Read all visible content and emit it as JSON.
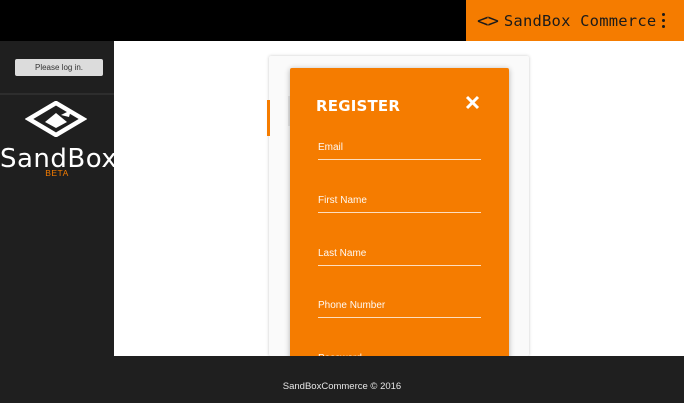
{
  "header": {
    "brand_glyph": "<>",
    "brand_name": "SandBox Commerce",
    "menu_icon": "more-vert-icon",
    "brand_color": "#f57c00",
    "bar_color": "#000000"
  },
  "sidebar": {
    "login_label": "Please log in.",
    "logo_icon": "sandbox-logo-icon",
    "logo_word": "SandBox",
    "logo_tag": "BETA"
  },
  "register": {
    "title": "REGISTER",
    "close_icon": "close-icon",
    "fields": {
      "email": {
        "placeholder": "Email",
        "value": ""
      },
      "first_name": {
        "placeholder": "First Name",
        "value": ""
      },
      "last_name": {
        "placeholder": "Last Name",
        "value": ""
      },
      "phone": {
        "placeholder": "Phone Number",
        "value": ""
      },
      "password": {
        "placeholder": "Password",
        "value": ""
      }
    },
    "accent": "#f57c00"
  },
  "footer": {
    "text": "SandBoxCommerce © 2016"
  }
}
